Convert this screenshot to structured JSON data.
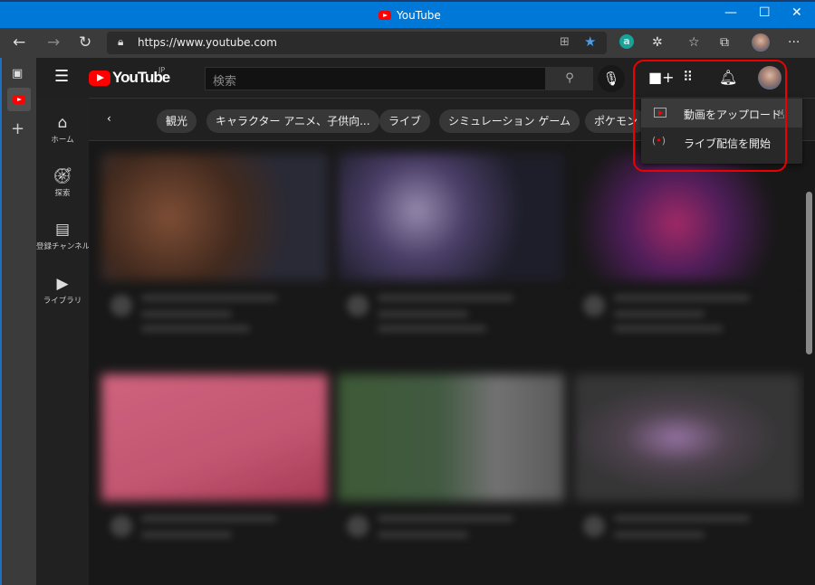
{
  "window": {
    "title": "YouTube",
    "controls": [
      "minimize",
      "maximize",
      "close"
    ]
  },
  "browser": {
    "url": "https://www.youtube.com",
    "icons": [
      "back-icon",
      "forward-icon",
      "refresh-icon",
      "lock-icon",
      "app-available-icon",
      "favorite-star-icon",
      "amazon-assistant-icon",
      "extensions-icon",
      "favorites-icon",
      "collections-icon",
      "profile-avatar",
      "more-icon"
    ]
  },
  "vertical_tabs": {
    "icons": [
      "tab-actions-icon",
      "youtube-tab",
      "new-tab-icon"
    ]
  },
  "youtube": {
    "logo": "YouTube",
    "region": "JP",
    "search": {
      "placeholder": "検索",
      "value": ""
    },
    "sidebar": [
      {
        "label": "ホーム",
        "icon": "home-icon"
      },
      {
        "label": "探索",
        "icon": "compass-icon"
      },
      {
        "label": "登録チャンネル",
        "icon": "subscriptions-icon"
      },
      {
        "label": "ライブラリ",
        "icon": "library-icon"
      }
    ],
    "chips": [
      "観光",
      "キャラクター アニメ、子供向...",
      "ライブ",
      "シミュレーション ゲーム",
      "ポケモン"
    ],
    "create_menu": {
      "items": [
        {
          "label": "動画をアップロード",
          "icon": "upload-video-icon"
        },
        {
          "label": "ライブ配信を開始",
          "icon": "go-live-icon"
        }
      ]
    },
    "accent": "#ff0000",
    "highlight_color": "#e00000"
  }
}
